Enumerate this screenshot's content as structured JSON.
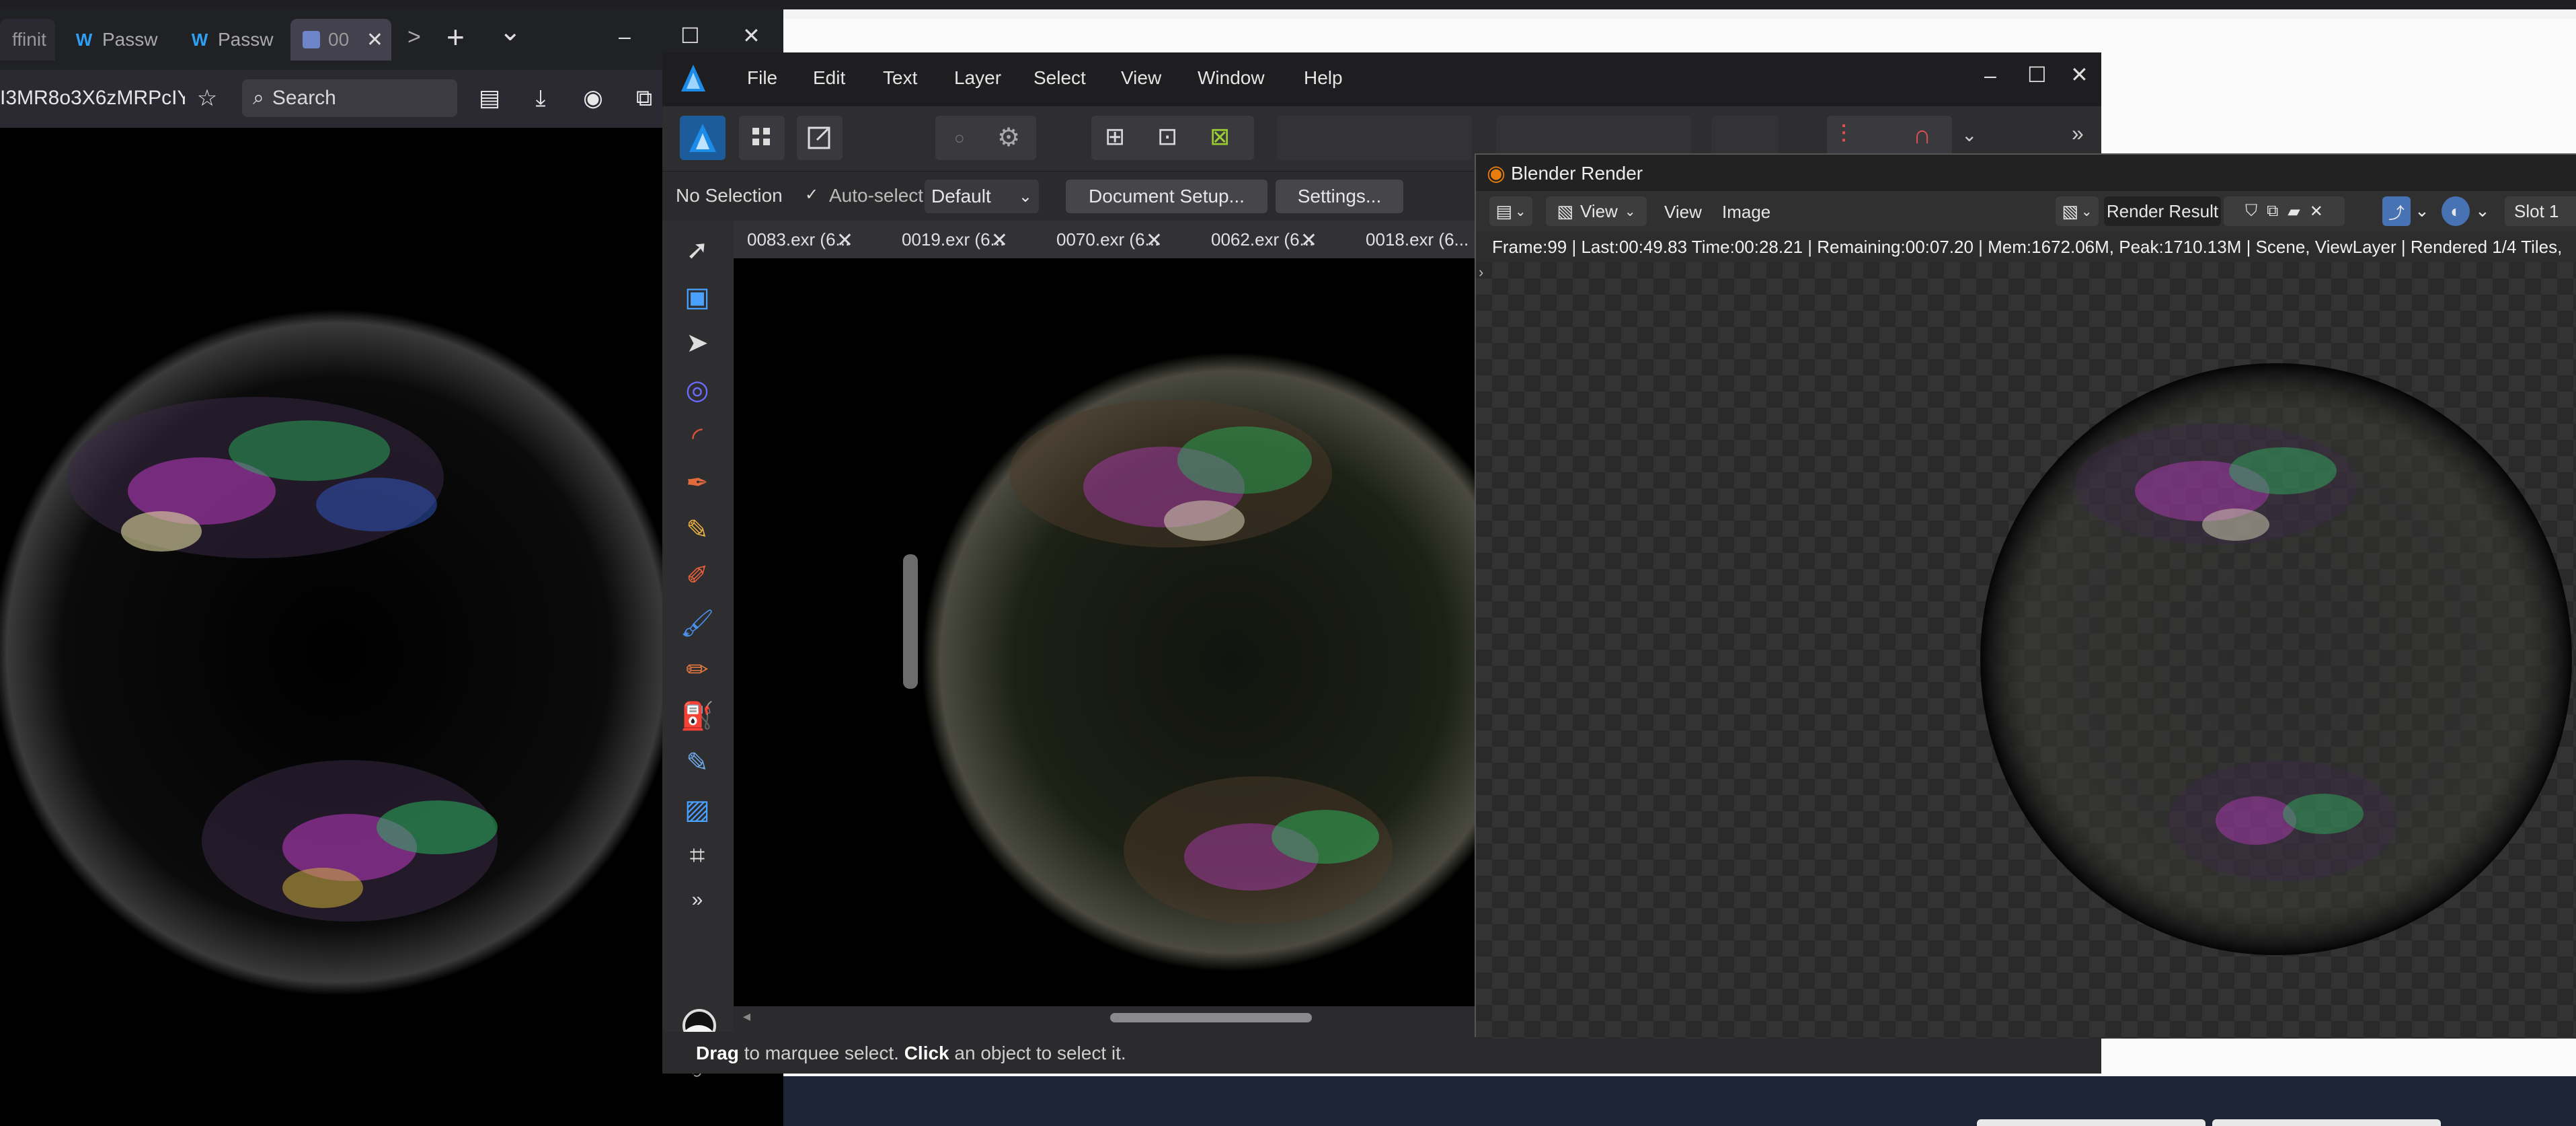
{
  "browser": {
    "tabs": [
      {
        "label": "ffinit",
        "icon": "affinity-icon"
      },
      {
        "label": "Passw",
        "icon": "passware-icon"
      },
      {
        "label": "Passw",
        "icon": "passware-icon"
      },
      {
        "label": "00",
        "icon": "image-tab-icon"
      }
    ],
    "url_fragment": "I3MR8o3X6zMRPcIY",
    "search_placeholder": "Search",
    "window_controls": {
      "minimize": "–",
      "maximize": "☐",
      "close": "✕"
    },
    "new_tab": "+",
    "tab_list": "⌄",
    "tab_scroll": ">"
  },
  "affinity": {
    "menu": [
      "File",
      "Edit",
      "Text",
      "Layer",
      "Select",
      "View",
      "Window",
      "Help"
    ],
    "window_controls": {
      "minimize": "–",
      "maximize": "☐",
      "close": "✕"
    },
    "context": {
      "selection": "No Selection",
      "auto_select_label": "Auto-select:",
      "auto_select_value": "Default",
      "document_setup": "Document Setup...",
      "settings": "Settings..."
    },
    "doc_tabs": [
      "0083.exr (6...",
      "0019.exr (6...",
      "0070.exr (6...",
      "0062.exr (6...",
      "0018.exr (6..."
    ],
    "status": {
      "bold1": "Drag",
      "text1": " to marquee select. ",
      "bold2": "Click",
      "text2": " an object to select it."
    },
    "more_tools": "»",
    "more_toolbar": "»"
  },
  "blender": {
    "title": "Blender Render",
    "header": {
      "view_dropdown": "View",
      "view_menu": "View",
      "image_menu": "Image",
      "render_result": "Render Result",
      "slot": "Slot 1"
    },
    "info": "Frame:99 | Last:00:49.83 Time:00:28.21 | Remaining:00:07.20 | Mem:1672.06M, Peak:1710.13M | Scene, ViewLayer | Rendered 1/4 Tiles,"
  },
  "colors": {
    "dark_bg": "#2b2b2e",
    "menubar": "#1e1e21",
    "affinity_blue": "#1d8be8",
    "blender_orange": "#e87d0d"
  }
}
